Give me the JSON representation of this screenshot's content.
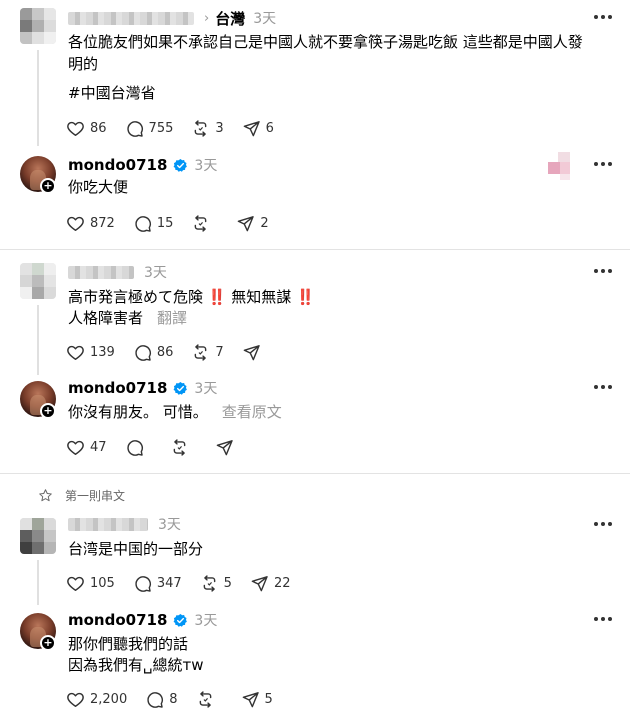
{
  "threads": [
    {
      "post": {
        "topic": "台灣",
        "time": "3天",
        "text_lines": [
          "各位脆友們如果不承認自己是中國人就不要拿筷子湯匙吃飯 這些都是中國人發",
          "明的"
        ],
        "hashtag": "#中國台灣省",
        "likes": "86",
        "replies": "755",
        "reposts": "3",
        "shares": "6"
      },
      "reply": {
        "username": "mondo0718",
        "time": "3天",
        "text_lines": [
          "你吃大便"
        ],
        "likes": "872",
        "replies": "15",
        "reposts": "",
        "shares": "2"
      }
    },
    {
      "post": {
        "time": "3天",
        "text_lines": [
          "高市発言極めて危険 ‼️ 無知無謀 ‼️",
          "人格障害者"
        ],
        "translate_label": "翻譯",
        "likes": "139",
        "replies": "86",
        "reposts": "7",
        "shares": ""
      },
      "reply": {
        "username": "mondo0718",
        "time": "3天",
        "text_lines": [
          "你沒有朋友。 可惜。"
        ],
        "translate_label": "查看原文",
        "likes": "47",
        "replies": "",
        "reposts": "",
        "shares": ""
      }
    },
    {
      "first_thread_label": "第一則串文",
      "post": {
        "time": "3天",
        "text_lines": [
          "台湾是中国的一部分"
        ],
        "likes": "105",
        "replies": "347",
        "reposts": "5",
        "shares": "22"
      },
      "reply": {
        "username": "mondo0718",
        "time": "3天",
        "text_lines": [
          "那你們聽我們的話",
          "因為我們有␣總統ᴛᴡ"
        ],
        "likes": "2,200",
        "replies": "8",
        "reposts": "",
        "shares": "5"
      }
    }
  ],
  "colors": {
    "verified": "#0095f6",
    "muted": "#999999",
    "divider": "#e3e3e3"
  },
  "icons": {
    "like": "heart-icon",
    "reply": "comment-icon",
    "repost": "repost-icon",
    "share": "send-icon",
    "more": "more-horizontal-icon",
    "first_thread": "star-icon"
  }
}
